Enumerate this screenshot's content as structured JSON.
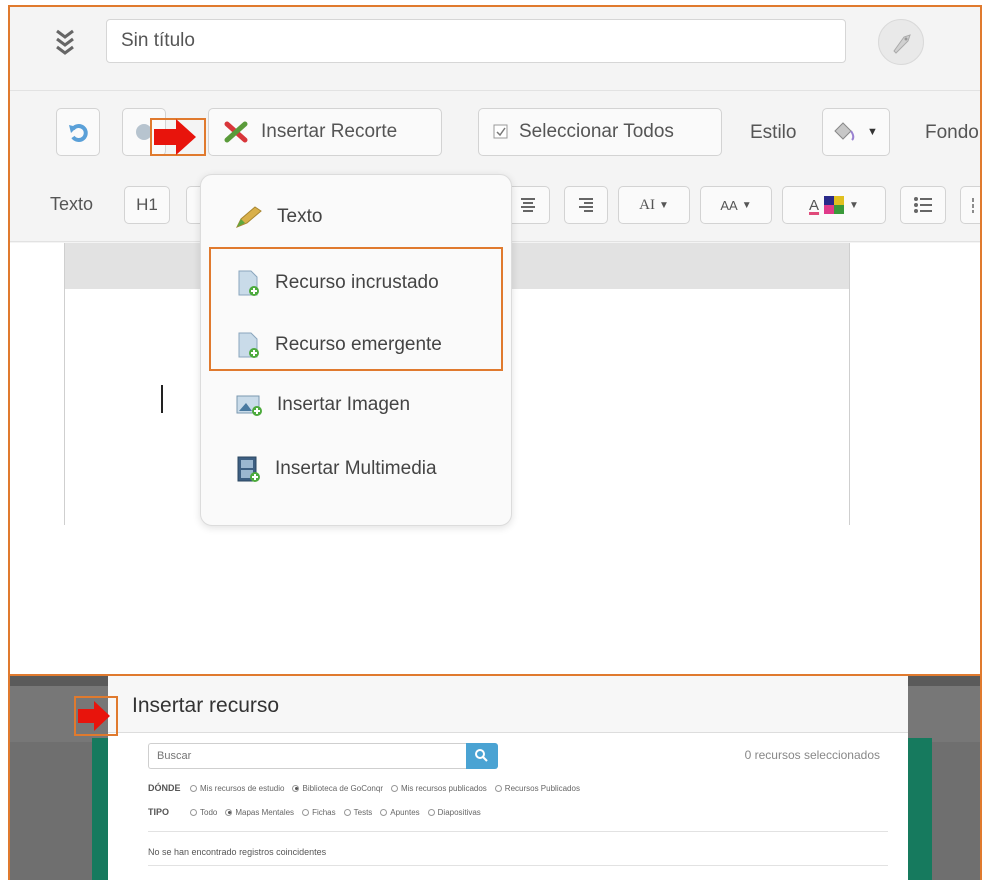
{
  "editor": {
    "title_value": "Sin título",
    "toolbar": {
      "insert_clip_label": "Insertar Recorte",
      "select_all_label": "Seleccionar Todos",
      "style_label": "Estilo",
      "background_label": "Fondo"
    },
    "format_bar": {
      "text_label": "Texto",
      "h1_label": "H1",
      "font_label": "AI",
      "font_size_label": "AA",
      "font_color_label": "A"
    },
    "insert_menu": {
      "items": [
        {
          "label": "Texto",
          "icon": "pencil-icon"
        },
        {
          "label": "Recurso incrustado",
          "icon": "document-add-icon"
        },
        {
          "label": "Recurso emergente",
          "icon": "document-add-icon"
        },
        {
          "label": "Insertar Imagen",
          "icon": "image-icon"
        },
        {
          "label": "Insertar Multimedia",
          "icon": "film-icon"
        }
      ]
    }
  },
  "dialog": {
    "title": "Insertar recurso",
    "search_placeholder": "Buscar",
    "selected_count": "0 recursos seleccionados",
    "where": {
      "label": "DÓNDE",
      "options": [
        "Mis recursos de estudio",
        "Biblioteca de GoConqr",
        "Mis recursos publicados",
        "Recursos Publicados"
      ],
      "selected": "Biblioteca de GoConqr"
    },
    "type": {
      "label": "TIPO",
      "options": [
        "Todo",
        "Mapas Mentales",
        "Fichas",
        "Tests",
        "Apuntes",
        "Diapositivas"
      ],
      "selected": "Mapas Mentales"
    },
    "no_results": "No se han encontrado registros coincidentes"
  },
  "colors": {
    "highlight": "#e07a2e",
    "arrow": "#e8140c",
    "search_button": "#4aa3d3",
    "dialog_frame": "#167a5e"
  }
}
